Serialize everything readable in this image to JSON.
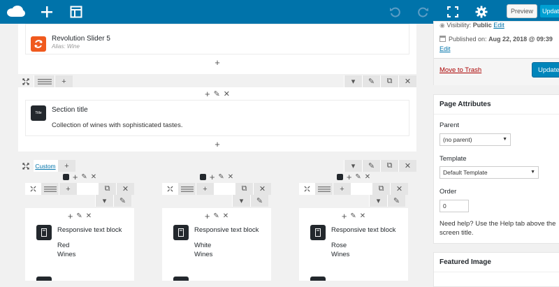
{
  "topbar": {
    "logo_icon": "cloud-logo-icon",
    "add_icon": "plus-icon",
    "layout_icon": "layout-icon",
    "undo_icon": "undo-icon",
    "redo_icon": "redo-icon",
    "fullscreen_icon": "fullscreen-icon",
    "settings_icon": "gear-icon",
    "preview_label": "Preview",
    "update_label": "Update"
  },
  "builder": {
    "slider_row": {
      "title": "Revolution Slider 5",
      "subtitle": "Alias: Wine"
    },
    "section_row": {
      "icon_text": "Title",
      "title": "Section title",
      "description": "Collection of wines with sophisticated tastes."
    },
    "columns_row": {
      "custom_label": "Custom",
      "columns": [
        {
          "title": "Responsive text block",
          "line1": "Red",
          "line2": "Wines"
        },
        {
          "title": "Responsive text block",
          "line1": "White",
          "line2": "Wines"
        },
        {
          "title": "Responsive text block",
          "line1": "Rose",
          "line2": "Wines"
        }
      ]
    }
  },
  "sidebar": {
    "publish": {
      "visibility_label": "Visibility:",
      "visibility_value": "Public",
      "visibility_edit": "Edit",
      "published_label": "Published on:",
      "published_value": "Aug 22, 2018 @ 09:39",
      "published_edit": "Edit",
      "trash_label": "Move to Trash",
      "update_label": "Update"
    },
    "page_attributes": {
      "heading": "Page Attributes",
      "parent_label": "Parent",
      "parent_value": "(no parent)",
      "template_label": "Template",
      "template_value": "Default Template",
      "order_label": "Order",
      "order_value": "0",
      "help_text": "Need help? Use the Help tab above the screen title."
    },
    "featured_image": {
      "heading": "Featured Image"
    }
  }
}
